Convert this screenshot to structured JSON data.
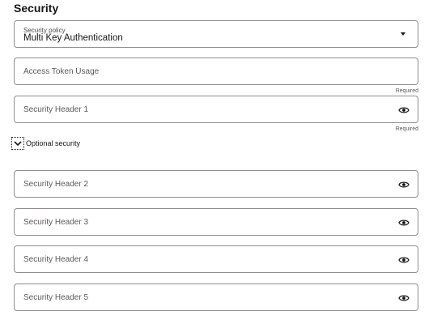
{
  "section": {
    "title": "Security"
  },
  "policy": {
    "label": "Security policy",
    "value": "Multi Key Authentication"
  },
  "access_token": {
    "placeholder": "Access Token Usage",
    "required_label": "Required"
  },
  "header1": {
    "placeholder": "Security Header 1",
    "required_label": "Required"
  },
  "optional": {
    "label": "Optional security"
  },
  "header2": {
    "placeholder": "Security Header 2"
  },
  "header3": {
    "placeholder": "Security Header 3"
  },
  "header4": {
    "placeholder": "Security Header 4"
  },
  "header5": {
    "placeholder": "Security Header 5"
  },
  "icons": {
    "password_toggle": "eye-icon",
    "dropdown": "chevron-down-icon",
    "expand": "chevron-down-icon"
  }
}
